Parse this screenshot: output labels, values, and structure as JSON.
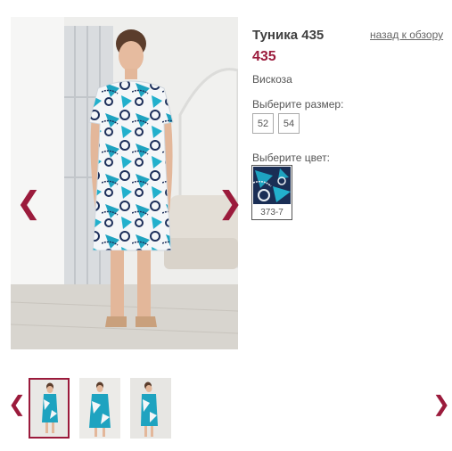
{
  "product": {
    "title": "Туника 435",
    "price": "435",
    "material": "Вискоза",
    "back_link": "назад к обзору"
  },
  "sizes": {
    "label": "Выберите размер:",
    "options": [
      "52",
      "54"
    ]
  },
  "colors": {
    "label": "Выберите цвет:",
    "options": [
      {
        "code": "373-7"
      }
    ]
  },
  "gallery": {
    "prev_icon": "chevron-left-icon",
    "next_icon": "chevron-right-icon",
    "prev_glyph": "❮",
    "next_glyph": "❯",
    "thumbnails": 3,
    "active_thumbnail": 1
  },
  "colors_palette": {
    "accent": "#9b1b3c",
    "print_turquoise": "#1ea3c0",
    "print_navy": "#1d2f5a"
  }
}
